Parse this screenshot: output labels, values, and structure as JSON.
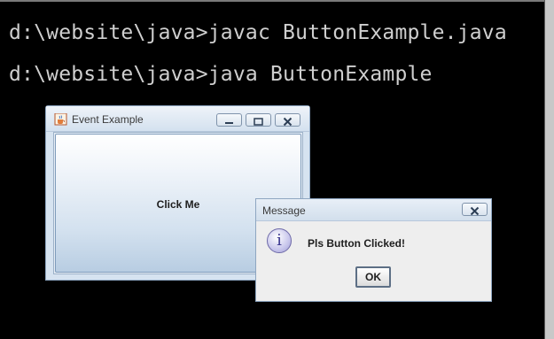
{
  "console": {
    "lines": [
      "d:\\website\\java>javac ButtonExample.java",
      "d:\\website\\java>java ButtonExample"
    ]
  },
  "event_window": {
    "title": "Event Example",
    "button_label": "Click Me",
    "icons": {
      "app": "java-cup-icon",
      "minimize": "minimize-icon",
      "maximize": "maximize-icon",
      "close": "close-icon"
    }
  },
  "message_dialog": {
    "title": "Message",
    "message": "Pls Button Clicked!",
    "ok_label": "OK",
    "icon_glyph": "i",
    "icons": {
      "info": "info-icon",
      "close": "close-icon"
    }
  },
  "colors": {
    "console_background": "#000000",
    "console_text": "#cfcfcf",
    "window_title_bar": "#d4e1ef",
    "dialog_background": "#eeeeee"
  }
}
